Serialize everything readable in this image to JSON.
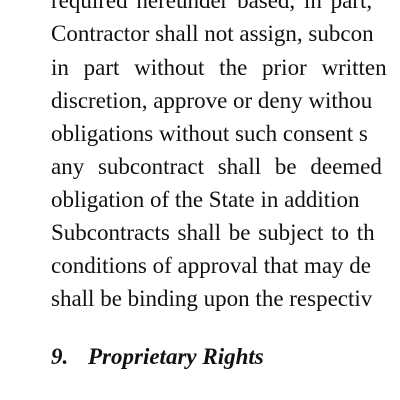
{
  "document": {
    "body_lines": [
      "required hereunder based, in part,",
      "Contractor shall not assign, subcon",
      "in part without the prior written",
      "discretion, approve or deny withou",
      "obligations without such consent s",
      "any subcontract shall be deemed",
      "obligation of the State in addition",
      "Subcontracts shall be subject to th",
      "conditions of approval that may de",
      "shall be binding upon the respectiv"
    ],
    "section_heading": {
      "number": "9.",
      "title": "Proprietary Rights"
    }
  }
}
